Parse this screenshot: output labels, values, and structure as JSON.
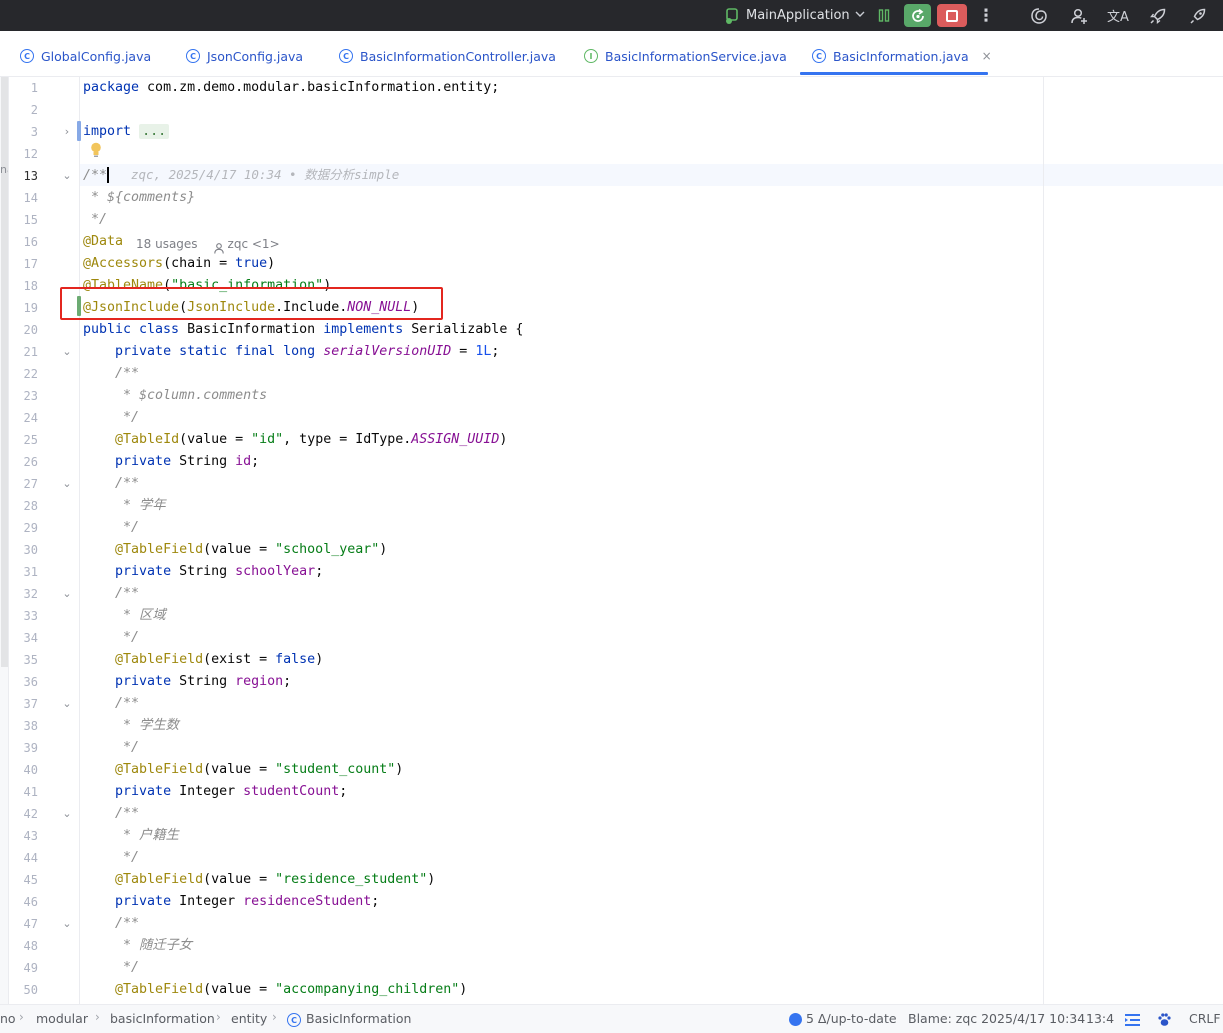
{
  "toolbar": {
    "run_config_label": "MainApplication",
    "icons": [
      "run-config-icon",
      "pause-icon",
      "rerun-icon",
      "stop-icon",
      "more-icon",
      "ai-assistant-icon",
      "add-user-icon",
      "translate-icon",
      "rocket-icon",
      "rocket-outline-icon"
    ],
    "more_glyph": "⋮",
    "translate_glyph": "文A"
  },
  "tabs": [
    {
      "label": "GlobalConfig.java",
      "icon": "C",
      "active": false
    },
    {
      "label": "JsonConfig.java",
      "icon": "C",
      "active": false
    },
    {
      "label": "BasicInformationController.java",
      "icon": "C",
      "active": false
    },
    {
      "label": "BasicInformationService.java",
      "icon": "I",
      "active": false
    },
    {
      "label": "BasicInformation.java",
      "icon": "C",
      "active": true,
      "close": "×"
    }
  ],
  "left_edge_fragment": "na",
  "editor": {
    "current_line": "13",
    "blame_inline": "zqc, 2025/4/17 10:34 • 数据分析simple",
    "inlay_hint": {
      "usages": "18 usages",
      "author": "zqc <1>"
    },
    "lines": [
      {
        "n": "1",
        "text": "package com.zm.demo.modular.basicInformation.entity;"
      },
      {
        "n": "2",
        "text": ""
      },
      {
        "n": "3",
        "text": "import ..."
      },
      {
        "n": "12",
        "text": ""
      },
      {
        "n": "13",
        "text": "/**"
      },
      {
        "n": "14",
        "text": " * ${comments}"
      },
      {
        "n": "15",
        "text": " */"
      },
      {
        "n": "16",
        "text": "@Data"
      },
      {
        "n": "17",
        "text": "@Accessors(chain = true)"
      },
      {
        "n": "18",
        "text": "@TableName(\"basic_information\")"
      },
      {
        "n": "19",
        "text": "@JsonInclude(JsonInclude.Include.NON_NULL)"
      },
      {
        "n": "20",
        "text": "public class BasicInformation implements Serializable {"
      },
      {
        "n": "21",
        "text": "    private static final long serialVersionUID = 1L;"
      },
      {
        "n": "22",
        "text": "    /**"
      },
      {
        "n": "23",
        "text": "     * $column.comments"
      },
      {
        "n": "24",
        "text": "     */"
      },
      {
        "n": "25",
        "text": "    @TableId(value = \"id\", type = IdType.ASSIGN_UUID)"
      },
      {
        "n": "26",
        "text": "    private String id;"
      },
      {
        "n": "27",
        "text": "    /**"
      },
      {
        "n": "28",
        "text": "     * 学年"
      },
      {
        "n": "29",
        "text": "     */"
      },
      {
        "n": "30",
        "text": "    @TableField(value = \"school_year\")"
      },
      {
        "n": "31",
        "text": "    private String schoolYear;"
      },
      {
        "n": "32",
        "text": "    /**"
      },
      {
        "n": "33",
        "text": "     * 区域"
      },
      {
        "n": "34",
        "text": "     */"
      },
      {
        "n": "35",
        "text": "    @TableField(exist = false)"
      },
      {
        "n": "36",
        "text": "    private String region;"
      },
      {
        "n": "37",
        "text": "    /**"
      },
      {
        "n": "38",
        "text": "     * 学生数"
      },
      {
        "n": "39",
        "text": "     */"
      },
      {
        "n": "40",
        "text": "    @TableField(value = \"student_count\")"
      },
      {
        "n": "41",
        "text": "    private Integer studentCount;"
      },
      {
        "n": "42",
        "text": "    /**"
      },
      {
        "n": "43",
        "text": "     * 户籍生"
      },
      {
        "n": "44",
        "text": "     */"
      },
      {
        "n": "45",
        "text": "    @TableField(value = \"residence_student\")"
      },
      {
        "n": "46",
        "text": "    private Integer residenceStudent;"
      },
      {
        "n": "47",
        "text": "    /**"
      },
      {
        "n": "48",
        "text": "     * 随迁子女"
      },
      {
        "n": "49",
        "text": "     */"
      },
      {
        "n": "50",
        "text": "    @TableField(value = \"accompanying_children\")"
      }
    ]
  },
  "statusbar": {
    "breadcrumbs": [
      "no",
      "modular",
      "basicInformation",
      "entity",
      "BasicInformation"
    ],
    "vcs_status": "5 Δ/up-to-date",
    "blame": "Blame: zqc 2025/4/17 10:34",
    "caret_position": "13:4",
    "line_separator": "CRLF"
  },
  "colors": {
    "keyword": "#0033b3",
    "annotation": "#9e880d",
    "string": "#067d17",
    "comment": "#8c8c8c",
    "constant": "#871094",
    "highlight_box": "#e3261f",
    "accent": "#3574f0"
  }
}
